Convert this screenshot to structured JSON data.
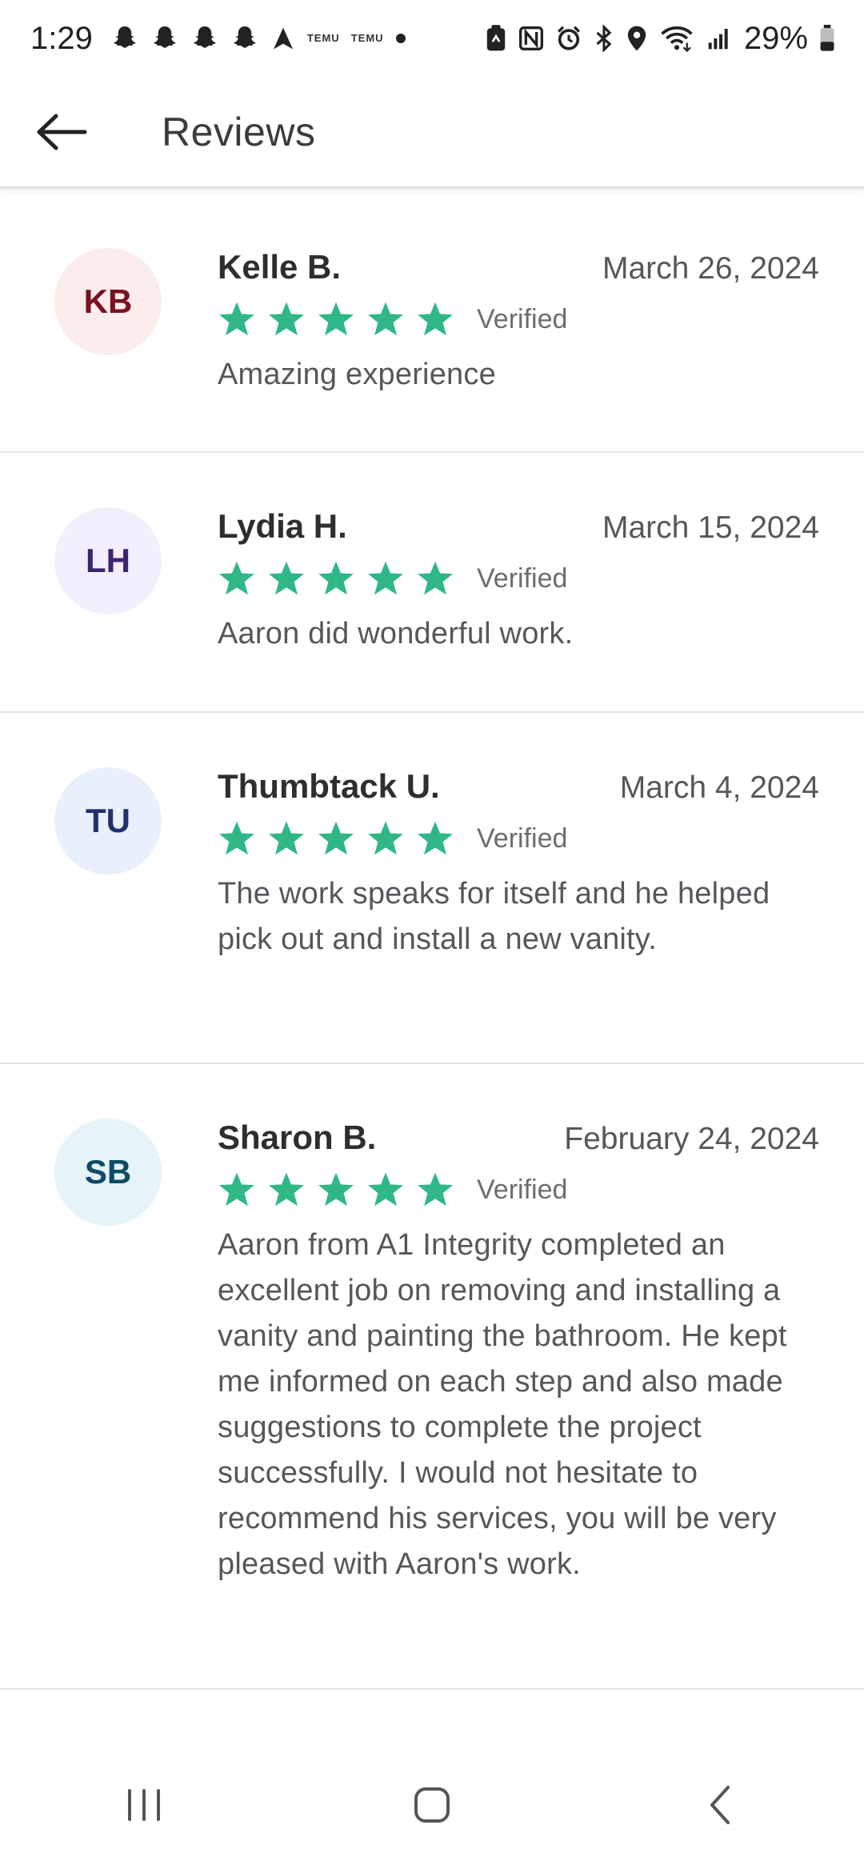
{
  "status_bar": {
    "time": "1:29",
    "temu_1": "TEMU",
    "temu_2": "TEMU",
    "battery": "29%"
  },
  "app_bar": {
    "title": "Reviews"
  },
  "reviews": [
    {
      "initials": "KB",
      "avatar_bg": "#fdecec",
      "avatar_fg": "#7a1020",
      "name": "Kelle B.",
      "date": "March 26, 2024",
      "stars": 5,
      "verified": "Verified",
      "text": "Amazing experience"
    },
    {
      "initials": "LH",
      "avatar_bg": "#f3eefc",
      "avatar_fg": "#3d2470",
      "name": "Lydia H.",
      "date": "March 15, 2024",
      "stars": 5,
      "verified": "Verified",
      "text": "Aaron did wonderful work."
    },
    {
      "initials": "TU",
      "avatar_bg": "#e9effc",
      "avatar_fg": "#23306e",
      "name": "Thumbtack U.",
      "date": "March 4, 2024",
      "stars": 5,
      "verified": "Verified",
      "text": "The work speaks for itself and he helped pick out and install a new vanity."
    },
    {
      "initials": "SB",
      "avatar_bg": "#e6f3f8",
      "avatar_fg": "#0e4b63",
      "name": "Sharon B.",
      "date": "February 24, 2024",
      "stars": 5,
      "verified": "Verified",
      "text": "Aaron from A1 Integrity completed an excellent job on removing and installing a vanity and painting the bathroom. He kept me informed on each step and also made suggestions to complete the project successfully. I would not hesitate to recommend his services, you will be very pleased with Aaron's work."
    }
  ],
  "colors": {
    "star": "#2fb886"
  }
}
